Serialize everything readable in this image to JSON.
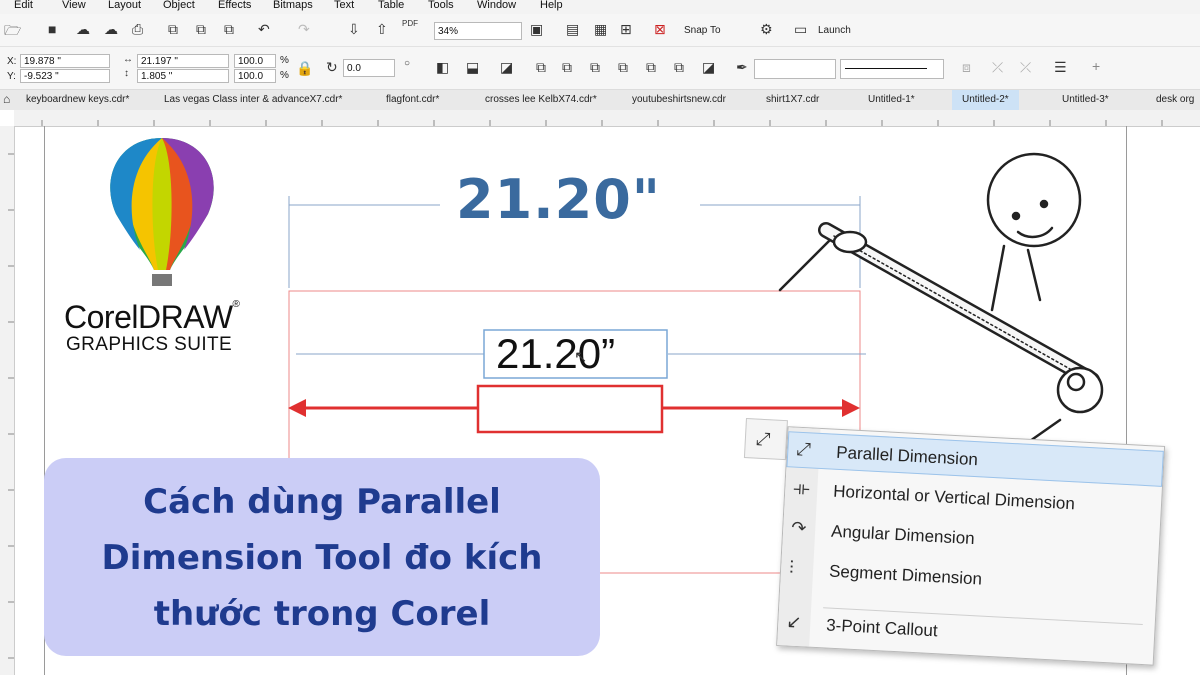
{
  "menu": [
    "Edit",
    "View",
    "Layout",
    "Object",
    "Effects",
    "Bitmaps",
    "Text",
    "Table",
    "Tools",
    "Window",
    "Help"
  ],
  "toolbar": {
    "zoom": "34%",
    "snap_to": "Snap To",
    "launch": "Launch",
    "pdf_label": "PDF"
  },
  "props": {
    "x_label": "X:",
    "x_value": "19.878 \"",
    "y_label": "Y:",
    "y_value": "-9.523 \"",
    "w_value": "21.197 \"",
    "h_value": "1.805 \"",
    "sx": "100.0",
    "sy": "100.0",
    "pct": "%",
    "angle": "0.0"
  },
  "tabs": [
    "keyboardnew keys.cdr*",
    "Las vegas Class inter & advanceX7.cdr*",
    "flagfont.cdr*",
    "crosses lee KelbX74.cdr*",
    "youtubeshirtsnew.cdr",
    "shirt1X7.cdr",
    "Untitled-1*",
    "Untitled-2*",
    "Untitled-3*",
    "desk org"
  ],
  "brand": {
    "name": "CorelDRAW",
    "reg": "®",
    "sub": "GRAPHICS SUITE"
  },
  "canvas": {
    "big_dimension": "21.20\"",
    "small_dimension": "21.20”"
  },
  "headline": {
    "line1": "Cách dùng Parallel",
    "line2": "Dimension Tool đo kích",
    "line3": "thước trong Corel"
  },
  "flyout": {
    "items": [
      {
        "label": "Parallel Dimension",
        "icon": "parallel-dimension-icon"
      },
      {
        "label": "Horizontal or Vertical Dimension",
        "icon": "horizontal-vertical-dimension-icon"
      },
      {
        "label": "Angular Dimension",
        "icon": "angular-dimension-icon"
      },
      {
        "label": "Segment Dimension",
        "icon": "segment-dimension-icon"
      },
      {
        "label": "3-Point Callout",
        "icon": "three-point-callout-icon"
      }
    ]
  },
  "colors": {
    "accent_red": "#e03030",
    "title_blue": "#3a6a9e",
    "headline_bg": "#cbcdf6",
    "headline_text": "#1f3b8f",
    "highlight": "#d8e8f8"
  }
}
